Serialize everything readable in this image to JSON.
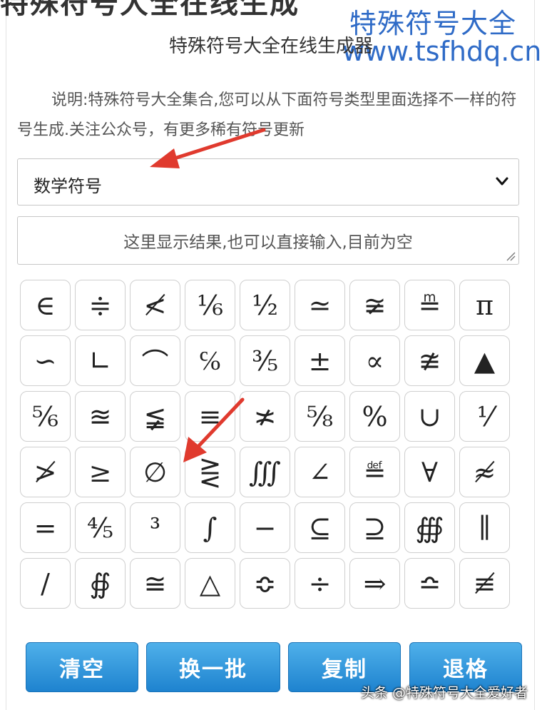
{
  "header": {
    "cut_banner": "特殊符号大全在线生成",
    "watermark_title": "特殊符号大全",
    "watermark_url": "www.tsfhdq.cn",
    "title": "特殊符号大全在线生成器"
  },
  "intro": "说明:特殊符号大全集合,您可以从下面符号类型里面选择不一样的符号生成.关注公众号，有更多稀有符号更新",
  "category_select": {
    "value": "数学符号",
    "icon": "chevron-down-icon"
  },
  "result": {
    "placeholder": "这里显示结果,也可以直接输入,目前为空"
  },
  "symbols": [
    "∈",
    "≑",
    "≮",
    "⅙",
    "½",
    "≃",
    "≆",
    "≞",
    "π",
    "∽",
    "∟",
    "⌒",
    "℅",
    "⅗",
    "±",
    "∝",
    "≇",
    "▲",
    "⅚",
    "≊",
    "≨",
    "≡",
    "≭",
    "⅝",
    "%",
    "∪",
    "⅟",
    "≯",
    "≥",
    "∅",
    "⋛",
    "∭",
    "∠",
    "≝",
    "∀",
    "≉",
    "=",
    "⅘",
    "³",
    "∫",
    "−",
    "⊆",
    "⊇",
    "∰",
    "∥",
    "/",
    "∯",
    "≅",
    "△",
    "≎",
    "÷",
    "⇒",
    "≏",
    "≢"
  ],
  "buttons": {
    "clear": "清空",
    "change": "换一批",
    "copy": "复制",
    "backspace": "退格"
  },
  "credit": "头条 @特殊符号大全爱好者",
  "colors": {
    "button": "#2a8fd8",
    "watermark": "#2f6bc7",
    "arrow": "#e03a2e"
  }
}
